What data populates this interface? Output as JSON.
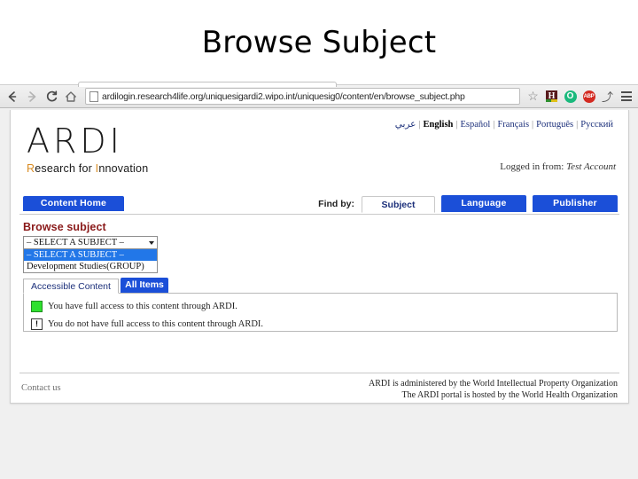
{
  "slide": {
    "title": "Browse Subject"
  },
  "browser": {
    "back_icon": "back-arrow-icon",
    "forward_icon": "forward-arrow-icon",
    "reload_label": "C",
    "home_icon": "home-icon",
    "url": "ardilogin.research4life.org/uniquesigardi2.wipo.int/uniquesig0/content/en/browse_subject.php",
    "star_glyph": "☆",
    "extensions": [
      {
        "name": "H",
        "title": "H"
      },
      {
        "name": "O",
        "title": "O"
      },
      {
        "name": "ABP",
        "title": "ABP"
      }
    ],
    "tool_glyph": "⤴",
    "menu_icon": "hamburger-menu-icon"
  },
  "page": {
    "logo": {
      "word": "ARDI",
      "tagline_pre": "R",
      "tagline_mid": "esearch for ",
      "tagline_accent": "I",
      "tagline_post": "nnovation"
    },
    "languages": [
      {
        "label": "عربي",
        "current": false
      },
      {
        "label": "English",
        "current": true
      },
      {
        "label": "Español",
        "current": false
      },
      {
        "label": "Français",
        "current": false
      },
      {
        "label": "Português",
        "current": false
      },
      {
        "label": "Русский",
        "current": false
      }
    ],
    "session": {
      "logged_in_label": "Logged in from:",
      "account": "Test Account"
    },
    "nav": {
      "content_home": "Content Home",
      "find_by_label": "Find by:",
      "tabs": [
        {
          "label": "Subject",
          "active": true
        },
        {
          "label": "Language",
          "active": false
        },
        {
          "label": "Publisher",
          "active": false
        }
      ]
    },
    "browse": {
      "heading": "Browse subject",
      "select_value": "– SELECT A SUBJECT –",
      "options": [
        {
          "label": "– SELECT A SUBJECT –",
          "selected": true
        },
        {
          "label": "Development Studies(GROUP)",
          "selected": false
        }
      ]
    },
    "content_tabs": [
      {
        "label": "Accessible Content",
        "active": true
      },
      {
        "label": "All Items",
        "active": false
      }
    ],
    "legend": [
      {
        "icon": "green-square-icon",
        "glyph": "",
        "text": "You have full access to this content through ARDI."
      },
      {
        "icon": "warning-square-icon",
        "glyph": "!",
        "text": "You do not have full access to this content through ARDI."
      }
    ],
    "footer": {
      "contact": "Contact us",
      "line1": "ARDI is administered by the World Intellectual Property Organization",
      "line2": "The ARDI portal is hosted by the World Health Organization"
    }
  },
  "colors": {
    "brand_blue": "#1b4fd8",
    "heading_red": "#8a1a1a",
    "accent_orange": "#d98c23",
    "access_green": "#2ee02e",
    "select_highlight": "#2277e8"
  }
}
